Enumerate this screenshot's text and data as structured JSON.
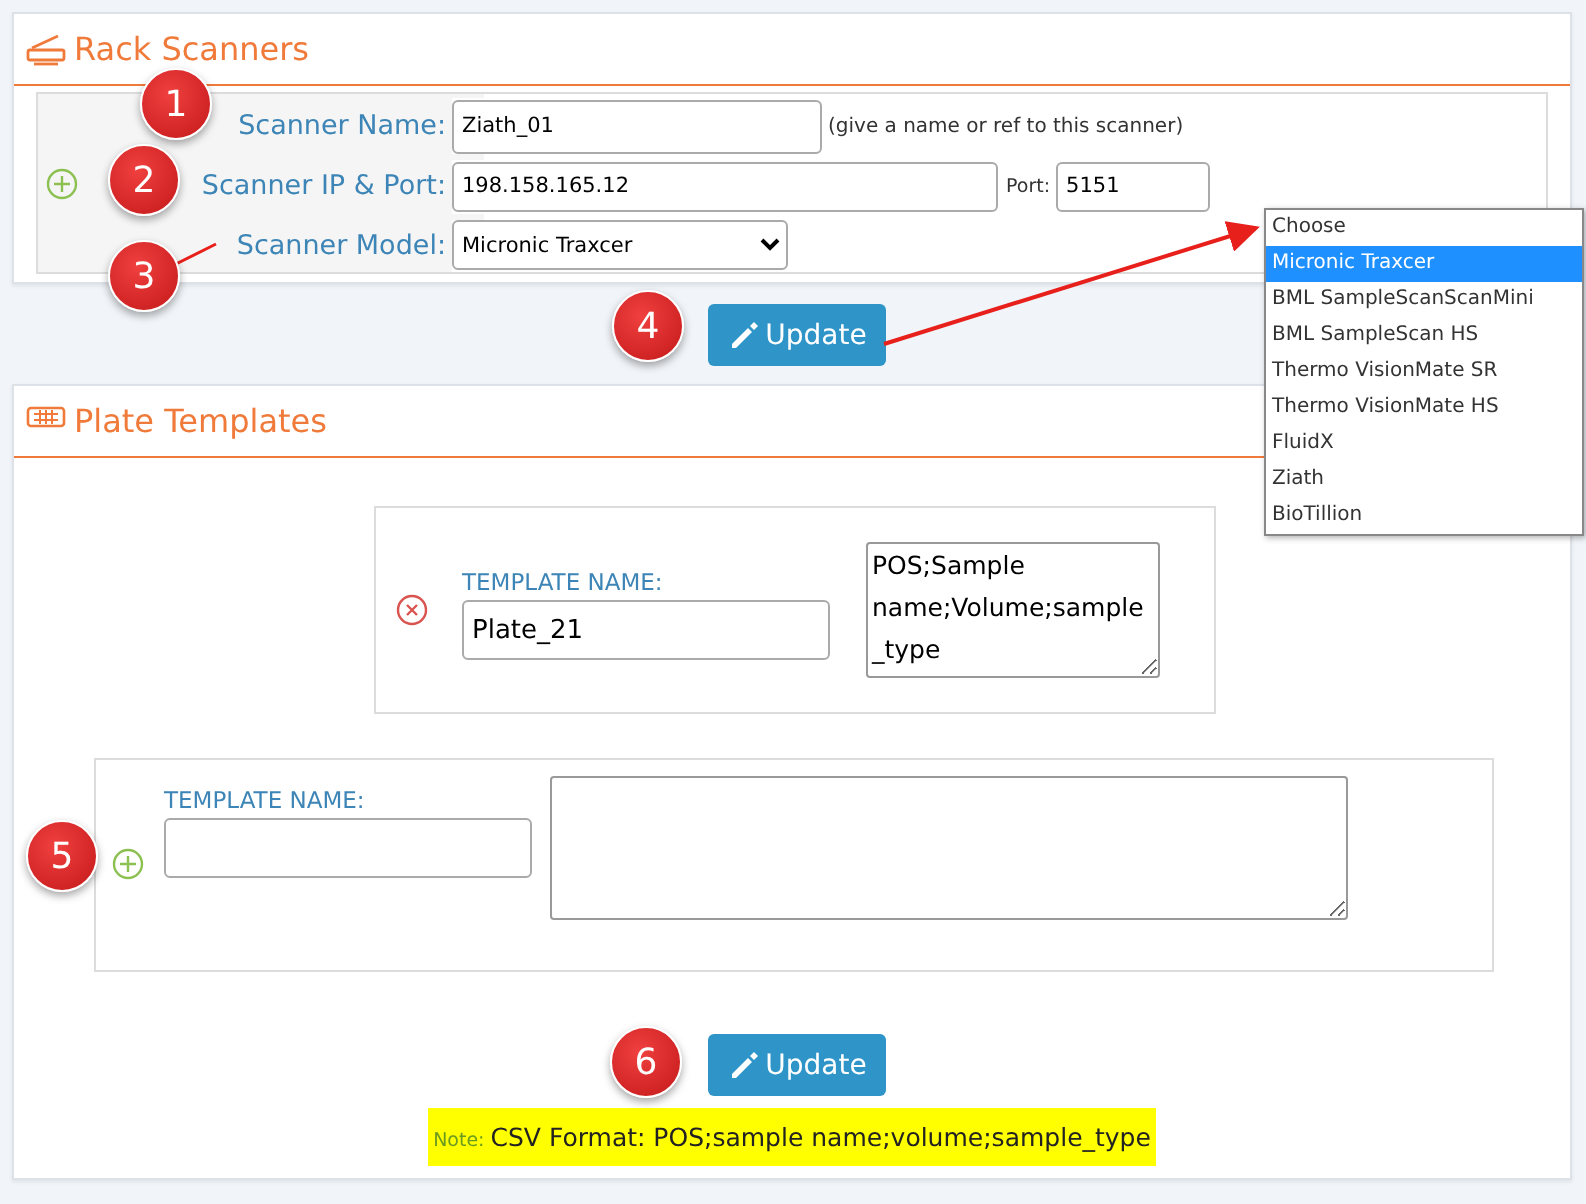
{
  "rack_scanners": {
    "title": "Rack Scanners",
    "name_field": {
      "label": "Scanner Name:",
      "value": "Ziath_01",
      "hint": "(give a name or ref to this scanner)"
    },
    "ip_field": {
      "label": "Scanner IP & Port:",
      "value": "198.158.165.12",
      "port_label": "Port:",
      "port_value": "5151"
    },
    "model_field": {
      "label": "Scanner Model:",
      "value": "Micronic Traxcer"
    },
    "update_button": "Update"
  },
  "model_dropdown": {
    "options": [
      {
        "label": "Choose",
        "selected": false
      },
      {
        "label": "Micronic Traxcer",
        "selected": true
      },
      {
        "label": "BML SampleScanScanMini",
        "selected": false
      },
      {
        "label": "BML SampleScan HS",
        "selected": false
      },
      {
        "label": "Thermo VisionMate SR",
        "selected": false
      },
      {
        "label": "Thermo VisionMate HS",
        "selected": false
      },
      {
        "label": "FluidX",
        "selected": false
      },
      {
        "label": "Ziath",
        "selected": false
      },
      {
        "label": "BioTillion",
        "selected": false
      }
    ]
  },
  "plate_templates": {
    "title": "Plate Templates",
    "templates": [
      {
        "kind": "existing",
        "label": "TEMPLATE NAME:",
        "name": "Plate_21",
        "csv": "POS;Sample name;Volume;sample_type"
      },
      {
        "kind": "new",
        "label": "TEMPLATE NAME:"
      }
    ],
    "update_button": "Update",
    "note": {
      "label": "Note:",
      "text": "CSV Format: POS;sample name;volume;sample_type"
    }
  },
  "callouts": [
    "1",
    "2",
    "3",
    "4",
    "5",
    "6"
  ]
}
